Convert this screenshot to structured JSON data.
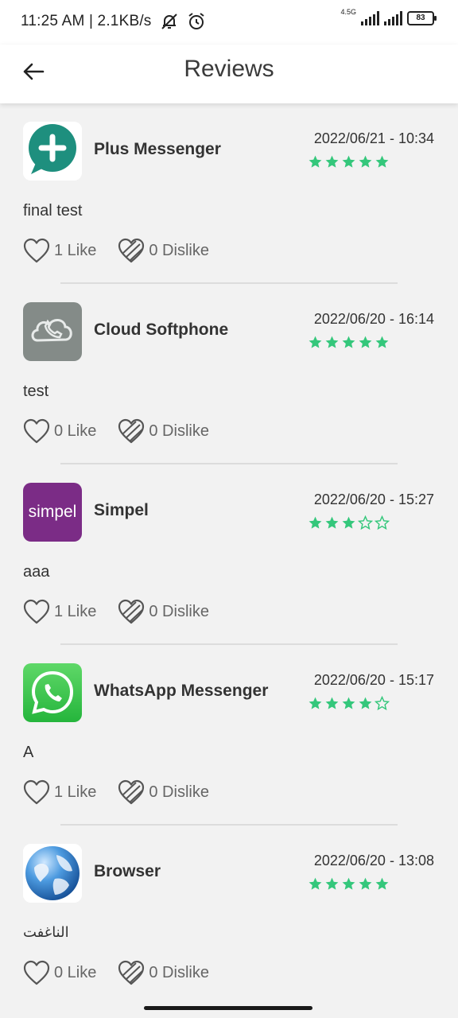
{
  "status": {
    "time": "11:25 AM | 2.1KB/s",
    "network": "4.5G",
    "battery": "83"
  },
  "header": {
    "title": "Reviews"
  },
  "colors": {
    "star": "#34c77b",
    "accent": "#ffffff"
  },
  "reviews": [
    {
      "app": "Plus Messenger",
      "icon": "plus-messenger-icon",
      "date": "2022/06/21 - 10:34",
      "rating": 5,
      "comment": "final test",
      "like": "1 Like",
      "dislike": "0 Dislike"
    },
    {
      "app": "Cloud Softphone",
      "icon": "cloud-softphone-icon",
      "date": "2022/06/20 - 16:14",
      "rating": 5,
      "comment": "test",
      "like": "0 Like",
      "dislike": "0 Dislike"
    },
    {
      "app": "Simpel",
      "icon": "simpel-icon",
      "icon_text": "simpel",
      "date": "2022/06/20 - 15:27",
      "rating": 3,
      "comment": "aaa",
      "like": "1 Like",
      "dislike": "0 Dislike"
    },
    {
      "app": "WhatsApp Messenger",
      "icon": "whatsapp-icon",
      "date": "2022/06/20 - 15:17",
      "rating": 4,
      "comment": "A",
      "like": "1 Like",
      "dislike": "0 Dislike"
    },
    {
      "app": "Browser",
      "icon": "browser-globe-icon",
      "date": "2022/06/20 - 13:08",
      "rating": 5,
      "comment": "الناغفت",
      "like": "0 Like",
      "dislike": "0 Dislike"
    }
  ]
}
